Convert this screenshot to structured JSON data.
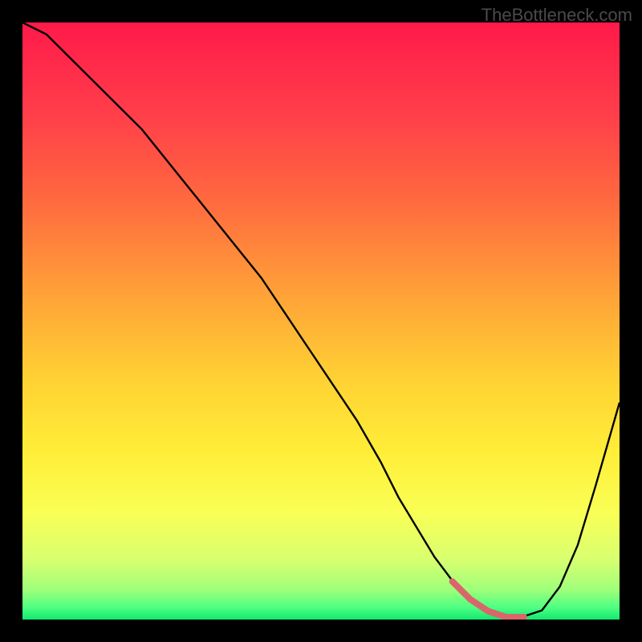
{
  "watermark": "TheBottleneck.com",
  "chart_data": {
    "type": "line",
    "title": "",
    "xlabel": "",
    "ylabel": "",
    "xlim": [
      0,
      100
    ],
    "ylim": [
      0,
      100
    ],
    "x": [
      0,
      4,
      8,
      12,
      16,
      20,
      24,
      28,
      32,
      36,
      40,
      44,
      48,
      52,
      56,
      60,
      63,
      66,
      69,
      72,
      75,
      78,
      81,
      84,
      87,
      90,
      93,
      96,
      100
    ],
    "values": [
      100,
      98,
      94,
      90,
      86,
      82,
      77,
      72,
      67,
      62,
      57,
      51,
      45,
      39,
      33,
      26,
      20,
      15,
      10,
      6,
      3,
      1,
      0,
      0,
      1,
      5,
      12,
      22,
      36
    ],
    "highlight_region": {
      "x_start": 70,
      "x_end": 86,
      "color": "#d9666b",
      "thickness": 8,
      "description": "bottleneck minimum zone"
    },
    "gradient_stops": [
      {
        "pos": 0.0,
        "color": "#ff1a4a"
      },
      {
        "pos": 0.15,
        "color": "#ff3d4a"
      },
      {
        "pos": 0.3,
        "color": "#ff6a3f"
      },
      {
        "pos": 0.45,
        "color": "#ffa038"
      },
      {
        "pos": 0.6,
        "color": "#ffd233"
      },
      {
        "pos": 0.72,
        "color": "#ffee38"
      },
      {
        "pos": 0.82,
        "color": "#faff55"
      },
      {
        "pos": 0.9,
        "color": "#d8ff70"
      },
      {
        "pos": 0.95,
        "color": "#9fff7a"
      },
      {
        "pos": 0.98,
        "color": "#4dff82"
      },
      {
        "pos": 1.0,
        "color": "#12e86e"
      }
    ]
  }
}
